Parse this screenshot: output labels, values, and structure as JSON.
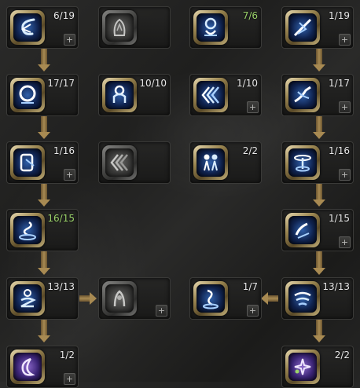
{
  "skill_tree": {
    "plus_label": "+",
    "nodes": [
      {
        "count": "6/19",
        "icon": "swirl-wind-icon",
        "state": "active"
      },
      {
        "count": "",
        "icon": "shadow-figure-icon",
        "state": "locked"
      },
      {
        "count": "7/6",
        "icon": "spirit-orb-icon",
        "state": "active",
        "over_cap": true
      },
      {
        "count": "1/19",
        "icon": "dash-strike-icon",
        "state": "active"
      },
      {
        "count": "17/17",
        "icon": "ring-target-icon",
        "state": "active"
      },
      {
        "count": "10/10",
        "icon": "totem-icon",
        "state": "active"
      },
      {
        "count": "1/10",
        "icon": "triple-chevron-icon",
        "state": "active"
      },
      {
        "count": "1/17",
        "icon": "slash-wave-icon",
        "state": "active"
      },
      {
        "count": "1/16",
        "icon": "guardian-icon",
        "state": "active"
      },
      {
        "count": "",
        "icon": "triple-chevron-icon",
        "state": "locked"
      },
      {
        "count": "2/2",
        "icon": "twin-figures-icon",
        "state": "active"
      },
      {
        "count": "1/16",
        "icon": "spin-vortex-icon",
        "state": "active"
      },
      {
        "count": "16/15",
        "icon": "genie-smoke-icon",
        "state": "active",
        "over_cap": true
      },
      {
        "count": "1/15",
        "icon": "fist-strike-icon",
        "state": "active"
      },
      {
        "count": "13/13",
        "icon": "coiled-spirit-icon",
        "state": "active"
      },
      {
        "count": "",
        "icon": "hooded-figure-icon",
        "state": "locked"
      },
      {
        "count": "1/7",
        "icon": "summon-spirit-icon",
        "state": "active"
      },
      {
        "count": "13/13",
        "icon": "whirlwind-icon",
        "state": "active"
      },
      {
        "count": "1/2",
        "icon": "crescent-moon-icon",
        "state": "active",
        "purple": true
      },
      {
        "count": "2/2",
        "icon": "sparkle-star-icon",
        "state": "active",
        "purple": true
      }
    ]
  },
  "colors": {
    "count_text": "#e8e8e8",
    "over_cap_text": "#9bd36a",
    "frame_gold": "#c6b27a",
    "icon_blue": "#2f5fa8",
    "arrow_gold": "#a88a52"
  }
}
